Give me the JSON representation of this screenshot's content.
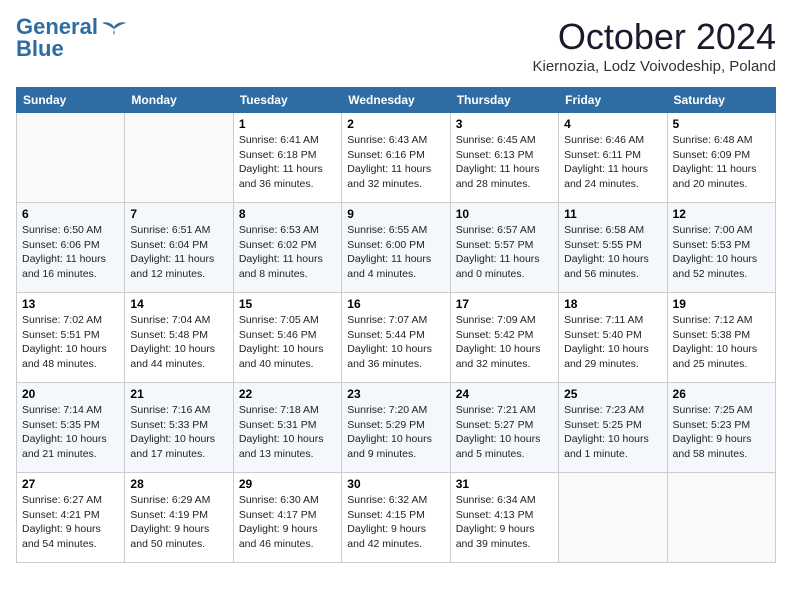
{
  "header": {
    "logo_line1": "General",
    "logo_line2": "Blue",
    "month": "October 2024",
    "location": "Kiernozia, Lodz Voivodeship, Poland"
  },
  "weekdays": [
    "Sunday",
    "Monday",
    "Tuesday",
    "Wednesday",
    "Thursday",
    "Friday",
    "Saturday"
  ],
  "weeks": [
    [
      {
        "day": "",
        "info": ""
      },
      {
        "day": "",
        "info": ""
      },
      {
        "day": "1",
        "info": "Sunrise: 6:41 AM\nSunset: 6:18 PM\nDaylight: 11 hours\nand 36 minutes."
      },
      {
        "day": "2",
        "info": "Sunrise: 6:43 AM\nSunset: 6:16 PM\nDaylight: 11 hours\nand 32 minutes."
      },
      {
        "day": "3",
        "info": "Sunrise: 6:45 AM\nSunset: 6:13 PM\nDaylight: 11 hours\nand 28 minutes."
      },
      {
        "day": "4",
        "info": "Sunrise: 6:46 AM\nSunset: 6:11 PM\nDaylight: 11 hours\nand 24 minutes."
      },
      {
        "day": "5",
        "info": "Sunrise: 6:48 AM\nSunset: 6:09 PM\nDaylight: 11 hours\nand 20 minutes."
      }
    ],
    [
      {
        "day": "6",
        "info": "Sunrise: 6:50 AM\nSunset: 6:06 PM\nDaylight: 11 hours\nand 16 minutes."
      },
      {
        "day": "7",
        "info": "Sunrise: 6:51 AM\nSunset: 6:04 PM\nDaylight: 11 hours\nand 12 minutes."
      },
      {
        "day": "8",
        "info": "Sunrise: 6:53 AM\nSunset: 6:02 PM\nDaylight: 11 hours\nand 8 minutes."
      },
      {
        "day": "9",
        "info": "Sunrise: 6:55 AM\nSunset: 6:00 PM\nDaylight: 11 hours\nand 4 minutes."
      },
      {
        "day": "10",
        "info": "Sunrise: 6:57 AM\nSunset: 5:57 PM\nDaylight: 11 hours\nand 0 minutes."
      },
      {
        "day": "11",
        "info": "Sunrise: 6:58 AM\nSunset: 5:55 PM\nDaylight: 10 hours\nand 56 minutes."
      },
      {
        "day": "12",
        "info": "Sunrise: 7:00 AM\nSunset: 5:53 PM\nDaylight: 10 hours\nand 52 minutes."
      }
    ],
    [
      {
        "day": "13",
        "info": "Sunrise: 7:02 AM\nSunset: 5:51 PM\nDaylight: 10 hours\nand 48 minutes."
      },
      {
        "day": "14",
        "info": "Sunrise: 7:04 AM\nSunset: 5:48 PM\nDaylight: 10 hours\nand 44 minutes."
      },
      {
        "day": "15",
        "info": "Sunrise: 7:05 AM\nSunset: 5:46 PM\nDaylight: 10 hours\nand 40 minutes."
      },
      {
        "day": "16",
        "info": "Sunrise: 7:07 AM\nSunset: 5:44 PM\nDaylight: 10 hours\nand 36 minutes."
      },
      {
        "day": "17",
        "info": "Sunrise: 7:09 AM\nSunset: 5:42 PM\nDaylight: 10 hours\nand 32 minutes."
      },
      {
        "day": "18",
        "info": "Sunrise: 7:11 AM\nSunset: 5:40 PM\nDaylight: 10 hours\nand 29 minutes."
      },
      {
        "day": "19",
        "info": "Sunrise: 7:12 AM\nSunset: 5:38 PM\nDaylight: 10 hours\nand 25 minutes."
      }
    ],
    [
      {
        "day": "20",
        "info": "Sunrise: 7:14 AM\nSunset: 5:35 PM\nDaylight: 10 hours\nand 21 minutes."
      },
      {
        "day": "21",
        "info": "Sunrise: 7:16 AM\nSunset: 5:33 PM\nDaylight: 10 hours\nand 17 minutes."
      },
      {
        "day": "22",
        "info": "Sunrise: 7:18 AM\nSunset: 5:31 PM\nDaylight: 10 hours\nand 13 minutes."
      },
      {
        "day": "23",
        "info": "Sunrise: 7:20 AM\nSunset: 5:29 PM\nDaylight: 10 hours\nand 9 minutes."
      },
      {
        "day": "24",
        "info": "Sunrise: 7:21 AM\nSunset: 5:27 PM\nDaylight: 10 hours\nand 5 minutes."
      },
      {
        "day": "25",
        "info": "Sunrise: 7:23 AM\nSunset: 5:25 PM\nDaylight: 10 hours\nand 1 minute."
      },
      {
        "day": "26",
        "info": "Sunrise: 7:25 AM\nSunset: 5:23 PM\nDaylight: 9 hours\nand 58 minutes."
      }
    ],
    [
      {
        "day": "27",
        "info": "Sunrise: 6:27 AM\nSunset: 4:21 PM\nDaylight: 9 hours\nand 54 minutes."
      },
      {
        "day": "28",
        "info": "Sunrise: 6:29 AM\nSunset: 4:19 PM\nDaylight: 9 hours\nand 50 minutes."
      },
      {
        "day": "29",
        "info": "Sunrise: 6:30 AM\nSunset: 4:17 PM\nDaylight: 9 hours\nand 46 minutes."
      },
      {
        "day": "30",
        "info": "Sunrise: 6:32 AM\nSunset: 4:15 PM\nDaylight: 9 hours\nand 42 minutes."
      },
      {
        "day": "31",
        "info": "Sunrise: 6:34 AM\nSunset: 4:13 PM\nDaylight: 9 hours\nand 39 minutes."
      },
      {
        "day": "",
        "info": ""
      },
      {
        "day": "",
        "info": ""
      }
    ]
  ]
}
